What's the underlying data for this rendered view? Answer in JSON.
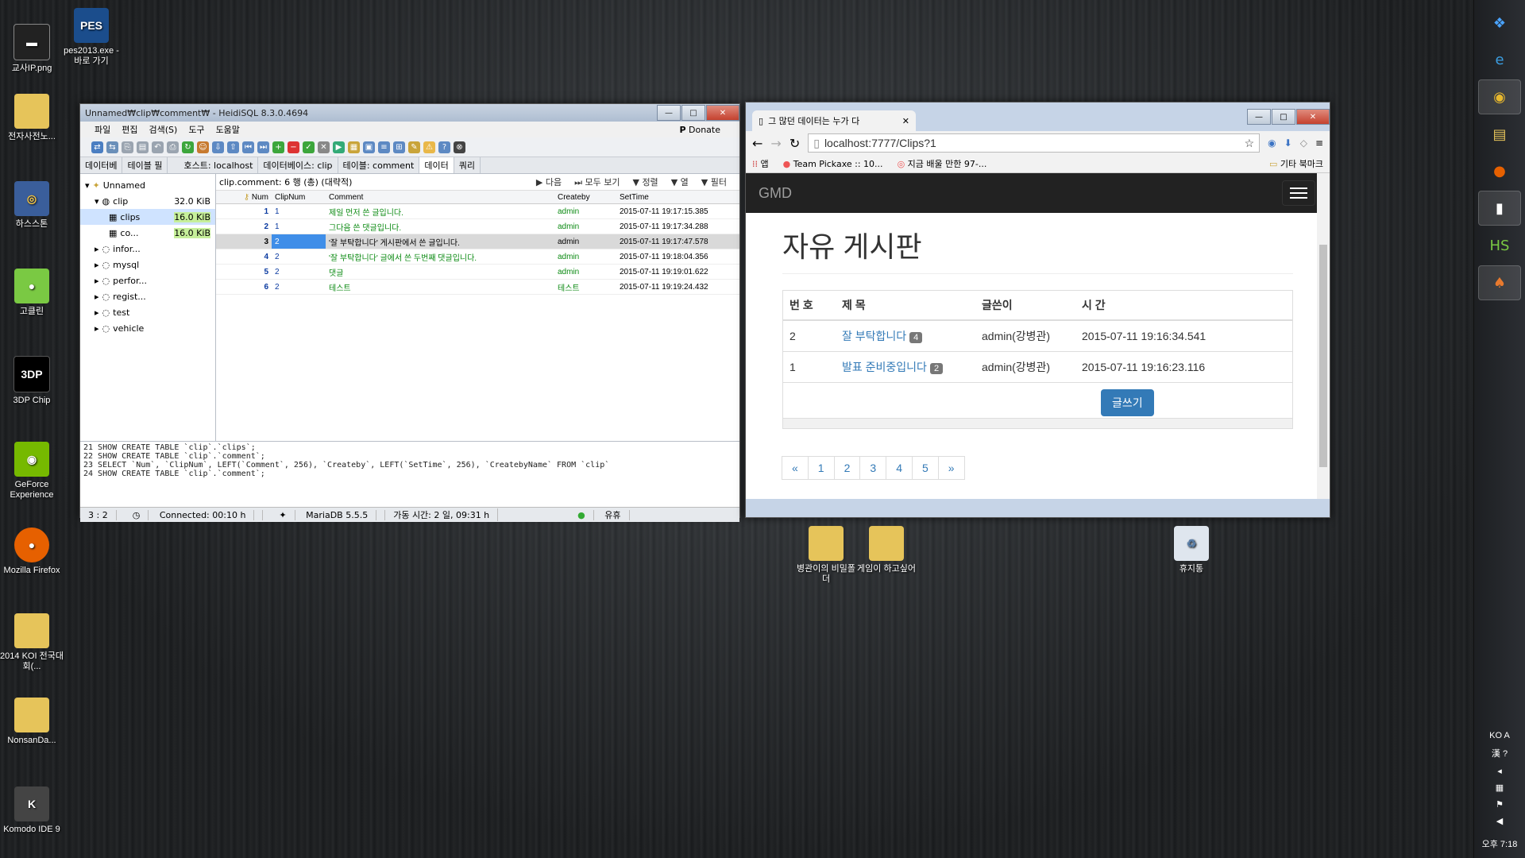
{
  "desktop": {
    "icons": [
      {
        "label": "교사IP.png"
      },
      {
        "label": "pes2013.exe - 바로 가기"
      },
      {
        "label": "전자사전노..."
      },
      {
        "label": "하스스톤"
      },
      {
        "label": "고클린"
      },
      {
        "label": "3DP Chip"
      },
      {
        "label": "GeForce Experience"
      },
      {
        "label": "Mozilla Firefox"
      },
      {
        "label": "2014 KOI 전국대회(..."
      },
      {
        "label": "NonsanDa..."
      },
      {
        "label": "Komodo IDE 9"
      },
      {
        "label": "병관이의 비밀폴더"
      },
      {
        "label": "게임이 하고싶어"
      },
      {
        "label": "휴지통"
      }
    ]
  },
  "heidi": {
    "title": "Unnamed₩clip₩comment₩ - HeidiSQL 8.3.0.4694",
    "menu": [
      "파일",
      "편집",
      "검색(S)",
      "도구",
      "도움말"
    ],
    "donate": "Donate",
    "left_tabs": [
      "데이터베",
      "테이블 필"
    ],
    "tabs": [
      "호스트: localhost",
      "데이터베이스: clip",
      "테이블: comment",
      "데이터",
      "쿼리"
    ],
    "tree": {
      "root": "Unnamed",
      "db": {
        "name": "clip",
        "size": "32.0 KiB"
      },
      "tables": [
        {
          "name": "clips",
          "size": "16.0 KiB"
        },
        {
          "name": "co...",
          "size": "16.0 KiB"
        }
      ],
      "others": [
        "infor...",
        "mysql",
        "perfor...",
        "regist...",
        "test",
        "vehicle"
      ]
    },
    "grid_info": "clip.comment: 6 행 (총) (대략적)",
    "grid_buttons": [
      "다음",
      "모두 보기",
      "정렬",
      "열",
      "필터"
    ],
    "columns": [
      "Num",
      "ClipNum",
      "Comment",
      "Createby",
      "SetTime"
    ],
    "rows": [
      {
        "num": "1",
        "clip": "1",
        "comment": "제일 먼저 쓴 글입니다.",
        "by": "admin",
        "time": "2015-07-11 19:17:15.385"
      },
      {
        "num": "2",
        "clip": "1",
        "comment": "그다음 쓴 댓글입니다.",
        "by": "admin",
        "time": "2015-07-11 19:17:34.288"
      },
      {
        "num": "3",
        "clip": "2",
        "comment": "'잘 부탁합니다' 게시판에서 쓴 글입니다.",
        "by": "admin",
        "time": "2015-07-11 19:17:47.578"
      },
      {
        "num": "4",
        "clip": "2",
        "comment": "'잘 부탁합니다' 글에서 쓴 두번째 댓글입니다.",
        "by": "admin",
        "time": "2015-07-11 19:18:04.356"
      },
      {
        "num": "5",
        "clip": "2",
        "comment": "댓글",
        "by": "admin",
        "time": "2015-07-11 19:19:01.622"
      },
      {
        "num": "6",
        "clip": "2",
        "comment": "테스트",
        "by": "테스트",
        "time": "2015-07-11 19:19:24.432"
      }
    ],
    "sql_lines": [
      "21 SHOW CREATE TABLE `clip`.`clips`;",
      "22 SHOW CREATE TABLE `clip`.`comment`;",
      "23 SELECT `Num`, `ClipNum`, LEFT(`Comment`, 256), `Createby`, LEFT(`SetTime`, 256), `CreatebyName` FROM `clip`",
      "24 SHOW CREATE TABLE `clip`.`comment`;"
    ],
    "status": [
      "3 : 2",
      "Connected: 00:10 h",
      "MariaDB 5.5.5",
      "가동 시간: 2 일, 09:31 h",
      "유휴"
    ]
  },
  "chrome": {
    "tab_title": "그 많던 데이터는 누가 다",
    "url": "localhost:7777/Clips?1",
    "bookmarks": [
      "앱",
      "Team Pickaxe :: 10...",
      "지금 배울 만한 97-...",
      "기타 북마크"
    ],
    "brand": "GMD",
    "page_title": "자유 게시판",
    "table_headers": [
      "번 호",
      "제 목",
      "글쓴이",
      "시 간"
    ],
    "posts": [
      {
        "no": "2",
        "title": "잘 부탁합니다",
        "count": "4",
        "author": "admin(강병관)",
        "time": "2015-07-11 19:16:34.541"
      },
      {
        "no": "1",
        "title": "발표 준비중입니다",
        "count": "2",
        "author": "admin(강병관)",
        "time": "2015-07-11 19:16:23.116"
      }
    ],
    "write_button": "글쓰기",
    "pager": [
      "«",
      "1",
      "2",
      "3",
      "4",
      "5",
      "»"
    ]
  },
  "tray": {
    "lang": "KO",
    "clock": "오후 7:18"
  }
}
